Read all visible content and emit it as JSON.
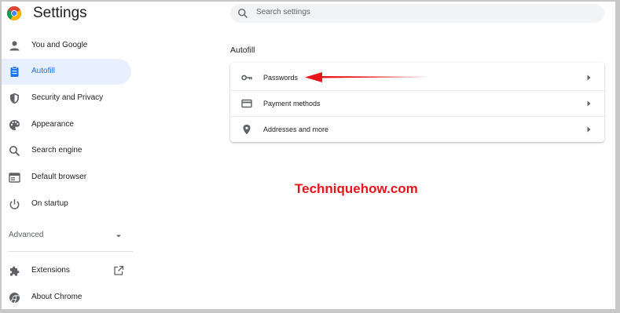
{
  "header": {
    "title": "Settings",
    "search_placeholder": "Search settings"
  },
  "sidebar": {
    "items": [
      {
        "label": "You and Google",
        "icon": "person-icon"
      },
      {
        "label": "Autofill",
        "icon": "clipboard-icon",
        "active": true
      },
      {
        "label": "Security and Privacy",
        "icon": "shield-icon"
      },
      {
        "label": "Appearance",
        "icon": "palette-icon"
      },
      {
        "label": "Search engine",
        "icon": "search-icon"
      },
      {
        "label": "Default browser",
        "icon": "browser-icon"
      },
      {
        "label": "On startup",
        "icon": "power-icon"
      }
    ],
    "advanced_label": "Advanced",
    "bottom_items": [
      {
        "label": "Extensions",
        "icon": "puzzle-icon"
      },
      {
        "label": "About Chrome",
        "icon": "chrome-icon"
      }
    ]
  },
  "main": {
    "section_title": "Autofill",
    "rows": [
      {
        "label": "Passwords",
        "icon": "key-icon"
      },
      {
        "label": "Payment methods",
        "icon": "credit-card-icon"
      },
      {
        "label": "Addresses and more",
        "icon": "location-pin-icon"
      }
    ]
  },
  "annotation": {
    "watermark": "Techniquehow.com",
    "arrow_color": "#e8161b"
  },
  "colors": {
    "accent": "#1a73e8",
    "active_bg": "#e8f0fe",
    "icon": "#5f6368"
  }
}
